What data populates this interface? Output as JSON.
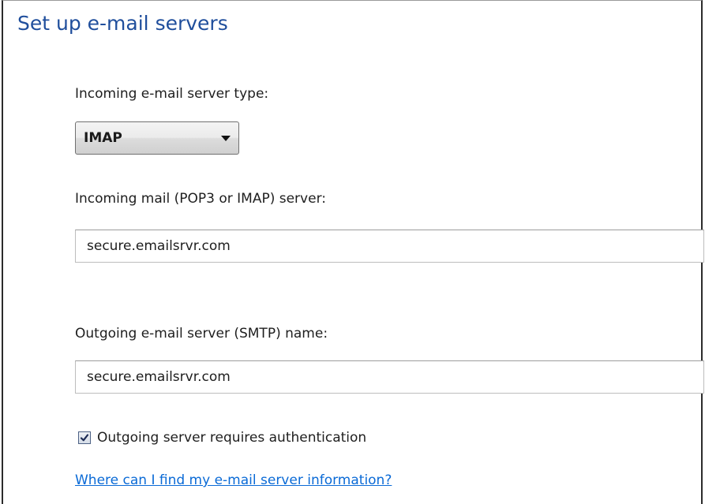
{
  "page": {
    "title": "Set up e-mail servers"
  },
  "form": {
    "incoming_type_label": "Incoming e-mail server type:",
    "incoming_type_value": "IMAP",
    "incoming_server_label": "Incoming mail (POP3 or IMAP) server:",
    "incoming_server_value": "secure.emailsrvr.com",
    "outgoing_server_label": "Outgoing e-mail server (SMTP) name:",
    "outgoing_server_value": "secure.emailsrvr.com",
    "auth_checkbox_label": "Outgoing server requires authentication",
    "auth_checkbox_checked": true,
    "help_link": "Where can I find my e-mail server information?"
  },
  "icons": {
    "dropdown": "chevron-down-icon",
    "checkbox": "checkmark-icon"
  },
  "colors": {
    "title": "#1f4e9c",
    "link": "#0a6ad6",
    "text": "#1e1e1e"
  }
}
